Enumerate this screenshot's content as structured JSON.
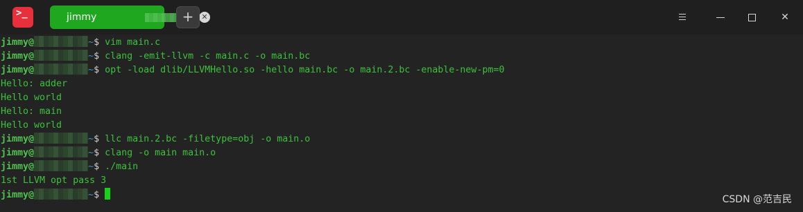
{
  "titlebar": {
    "app_icon_glyph": ">_",
    "tab": {
      "label": "jimmy",
      "chevron": "~"
    },
    "add_tab_label": "+"
  },
  "terminal": {
    "prompt_user": "jimmy@",
    "prompt_path": "~",
    "prompt_symbol": "$",
    "lines": [
      {
        "type": "prompt",
        "command": "vim main.c"
      },
      {
        "type": "prompt",
        "command": "clang -emit-llvm -c main.c -o main.bc"
      },
      {
        "type": "prompt",
        "command": "opt -load dlib/LLVMHello.so -hello main.bc -o main.2.bc -enable-new-pm=0"
      },
      {
        "type": "output",
        "text": "Hello: adder"
      },
      {
        "type": "output",
        "text": "Hello world"
      },
      {
        "type": "output",
        "text": "Hello: main"
      },
      {
        "type": "output",
        "text": "Hello world"
      },
      {
        "type": "prompt",
        "command": "llc main.2.bc -filetype=obj -o main.o"
      },
      {
        "type": "prompt",
        "command": "clang -o main main.o"
      },
      {
        "type": "prompt",
        "command": "./main"
      },
      {
        "type": "output",
        "text": "1st LLVM opt pass 3"
      },
      {
        "type": "prompt",
        "command": ""
      }
    ]
  },
  "watermark": "CSDN @范吉民",
  "colors": {
    "tab_active": "#1fa81f",
    "terminal_green": "#3cc23c",
    "path_blue": "#3f8fd8",
    "cursor": "#16d316",
    "app_icon": "#e8303c"
  }
}
